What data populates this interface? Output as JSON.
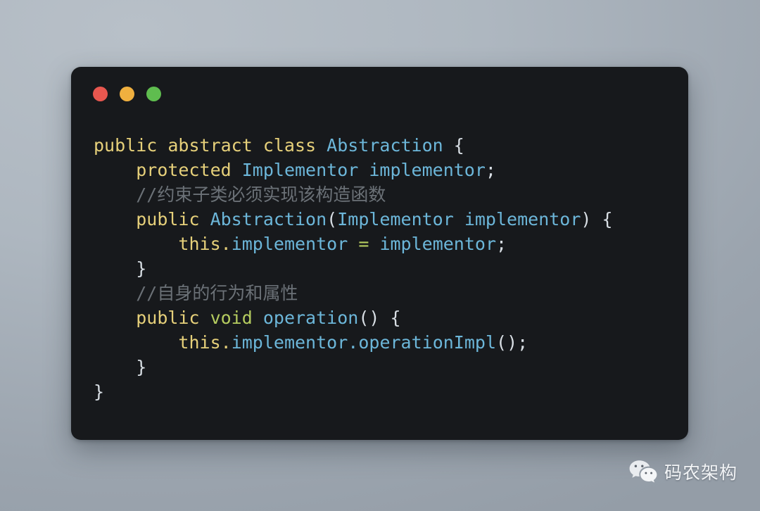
{
  "window": {
    "controls": [
      {
        "name": "close",
        "color": "#e8574f"
      },
      {
        "name": "minimize",
        "color": "#f0b03f"
      },
      {
        "name": "maximize",
        "color": "#5fbd4f"
      }
    ],
    "background": "#17191c"
  },
  "theme": {
    "page_background": "#a9b2bb",
    "keyword": "#e6d07a",
    "type": "#6cb6d9",
    "green": "#b5cc5f",
    "punctuation": "#d8dee4",
    "comment": "#6b7177"
  },
  "code": {
    "language": "java",
    "text": "public abstract class Abstraction {\n    protected Implementor implementor;\n    //约束子类必须实现该构造函数\n    public Abstraction(Implementor implementor) {\n        this.implementor = implementor;\n    }\n    //自身的行为和属性\n    public void operation() {\n        this.implementor.operationImpl();\n    }\n}",
    "lines": [
      {
        "id": "line-1",
        "tokens": [
          {
            "t": "public abstract class ",
            "c": "kw"
          },
          {
            "t": "Abstraction",
            "c": "typ"
          },
          {
            "t": " {",
            "c": "pun"
          }
        ]
      },
      {
        "id": "line-2",
        "tokens": [
          {
            "t": "    ",
            "c": "pun"
          },
          {
            "t": "protected ",
            "c": "kw"
          },
          {
            "t": "Implementor implementor",
            "c": "typ"
          },
          {
            "t": ";",
            "c": "pun"
          }
        ]
      },
      {
        "id": "line-3",
        "tokens": [
          {
            "t": "    ",
            "c": "pun"
          },
          {
            "t": "//约束子类必须实现该构造函数",
            "c": "cmt"
          }
        ]
      },
      {
        "id": "line-4",
        "tokens": [
          {
            "t": "    ",
            "c": "pun"
          },
          {
            "t": "public ",
            "c": "kw"
          },
          {
            "t": "Abstraction",
            "c": "typ"
          },
          {
            "t": "(",
            "c": "pun"
          },
          {
            "t": "Implementor implementor",
            "c": "typ"
          },
          {
            "t": ") {",
            "c": "pun"
          }
        ]
      },
      {
        "id": "line-5",
        "tokens": [
          {
            "t": "        ",
            "c": "pun"
          },
          {
            "t": "this",
            "c": "kw"
          },
          {
            "t": ".",
            "c": "kw"
          },
          {
            "t": "implementor ",
            "c": "typ"
          },
          {
            "t": "=",
            "c": "grn"
          },
          {
            "t": " implementor",
            "c": "typ"
          },
          {
            "t": ";",
            "c": "pun"
          }
        ]
      },
      {
        "id": "line-6",
        "tokens": [
          {
            "t": "    }",
            "c": "pun"
          }
        ]
      },
      {
        "id": "line-7",
        "tokens": [
          {
            "t": "    ",
            "c": "pun"
          },
          {
            "t": "//自身的行为和属性",
            "c": "cmt"
          }
        ]
      },
      {
        "id": "line-8",
        "tokens": [
          {
            "t": "    ",
            "c": "pun"
          },
          {
            "t": "public ",
            "c": "kw"
          },
          {
            "t": "void ",
            "c": "grn"
          },
          {
            "t": "operation",
            "c": "typ"
          },
          {
            "t": "() {",
            "c": "pun"
          }
        ]
      },
      {
        "id": "line-9",
        "tokens": [
          {
            "t": "        ",
            "c": "pun"
          },
          {
            "t": "this",
            "c": "kw"
          },
          {
            "t": ".",
            "c": "kw"
          },
          {
            "t": "implementor",
            "c": "typ"
          },
          {
            "t": ".",
            "c": "typ"
          },
          {
            "t": "operationImpl",
            "c": "typ"
          },
          {
            "t": "()",
            "c": "pun"
          },
          {
            "t": ";",
            "c": "pun"
          }
        ]
      },
      {
        "id": "line-10",
        "tokens": [
          {
            "t": "    }",
            "c": "pun"
          }
        ]
      },
      {
        "id": "line-11",
        "tokens": [
          {
            "t": "}",
            "c": "pun"
          }
        ]
      }
    ]
  },
  "watermark": {
    "icon": "wechat-icon",
    "label": "码农架构"
  }
}
